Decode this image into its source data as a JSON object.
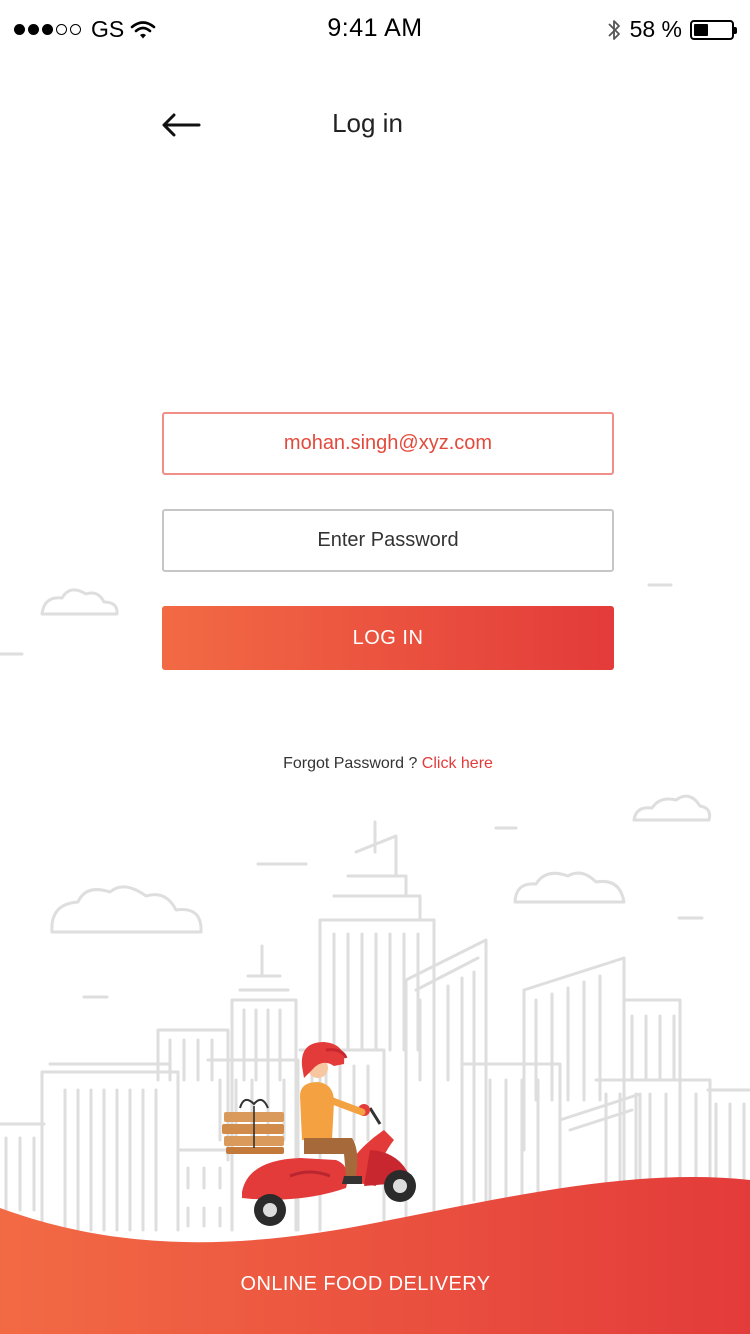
{
  "status_bar": {
    "carrier": "GS",
    "time": "9:41 AM",
    "battery_percent": "58 %",
    "battery_level": 0.4,
    "icons": [
      "signal-dots-icon",
      "wifi-icon",
      "bluetooth-icon",
      "battery-icon"
    ]
  },
  "header": {
    "back_icon": "arrow-left-icon",
    "title": "Log in"
  },
  "form": {
    "email_value": "mohan.singh@xyz.com",
    "password_placeholder": "Enter Password",
    "login_label": "LOG IN"
  },
  "forgot": {
    "text": "Forgot Password ?",
    "link": "Click here"
  },
  "footer": {
    "label": "ONLINE FOOD DELIVERY"
  },
  "colors": {
    "accent": "#e33b3a",
    "accent_start": "#f26a44",
    "email_text": "#e34a3c",
    "email_border": "#f08f88",
    "illustration_lines": "#d9d9d9"
  }
}
